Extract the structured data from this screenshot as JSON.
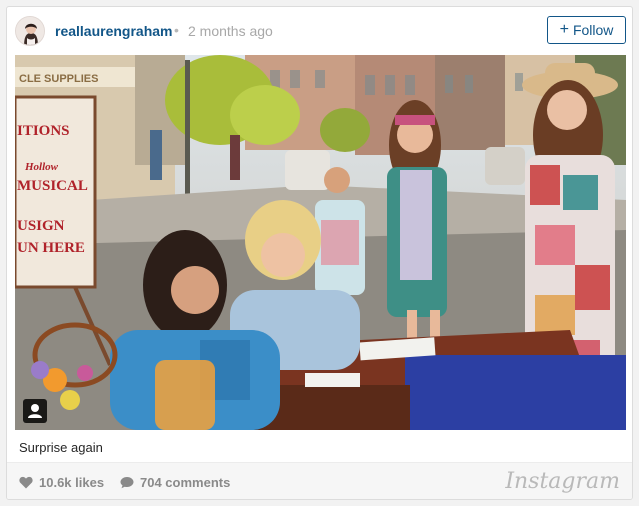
{
  "header": {
    "username": "reallaurengraham",
    "separator": "•",
    "timestamp": "2 months ago",
    "follow_label": "Follow",
    "follow_plus": "+",
    "accent": "#125688"
  },
  "post": {
    "caption": "Surprise again",
    "photo_sign_lines": [
      "ITIONS",
      "Hollow",
      "MUSICAL",
      "USIGN",
      "UN HERE"
    ],
    "shop_sign": "CLE SUPPLIES"
  },
  "footer": {
    "likes": "10.6k likes",
    "comments": "704 comments",
    "brand": "Instagram"
  },
  "icons": [
    "avatar-image",
    "user-tag-icon",
    "heart-icon",
    "comment-icon"
  ]
}
